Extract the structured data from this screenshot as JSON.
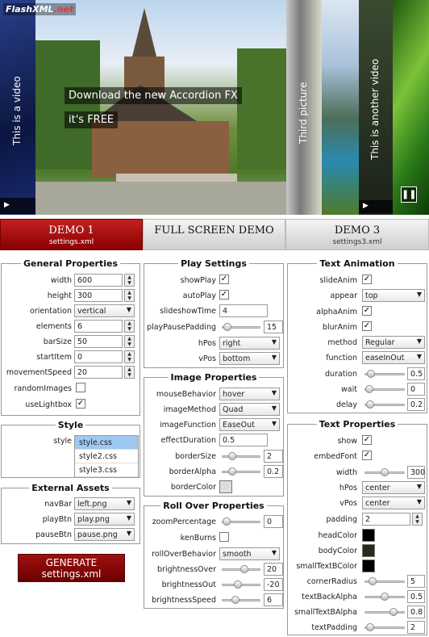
{
  "logo": {
    "flash": "FlashXML",
    "dotnet": ".net"
  },
  "slideshow": {
    "label_video1": "This is a video",
    "overlay_line1": "Download the new Accordion FX",
    "overlay_line2": "it's FREE",
    "label_third": "Third picture",
    "label_video2": "This is another video"
  },
  "tabs": [
    {
      "title": "DEMO 1",
      "file": "settings.xml",
      "active": true
    },
    {
      "title": "FULL SCREEN DEMO",
      "file": ""
    },
    {
      "title": "DEMO 3",
      "file": "settings3.xml"
    }
  ],
  "general": {
    "title": "General Properties",
    "width": {
      "label": "width",
      "value": "600"
    },
    "height": {
      "label": "height",
      "value": "300"
    },
    "orientation": {
      "label": "orientation",
      "value": "vertical"
    },
    "elements": {
      "label": "elements",
      "value": "6"
    },
    "barSize": {
      "label": "barSize",
      "value": "50"
    },
    "startItem": {
      "label": "startItem",
      "value": "0"
    },
    "movementSpeed": {
      "label": "movementSpeed",
      "value": "20"
    },
    "randomImages": {
      "label": "randomImages",
      "checked": false
    },
    "useLightbox": {
      "label": "useLightbox",
      "checked": true
    }
  },
  "style": {
    "title": "Style",
    "label": "style",
    "options": [
      "style.css",
      "style2.css",
      "style3.css"
    ],
    "selected": "style.css"
  },
  "external": {
    "title": "External Assets",
    "navBar": {
      "label": "navBar",
      "value": "left.png"
    },
    "playBtn": {
      "label": "playBtn",
      "value": "play.png"
    },
    "pauseBtn": {
      "label": "pauseBtn",
      "value": "pause.png"
    }
  },
  "generate": {
    "line1": "GENERATE",
    "line2": "settings.xml"
  },
  "play": {
    "title": "Play Settings",
    "showPlay": {
      "label": "showPlay",
      "checked": true
    },
    "autoPlay": {
      "label": "autoPlay",
      "checked": true
    },
    "slideshowTime": {
      "label": "slideshowTime",
      "value": "4"
    },
    "playPausePadding": {
      "label": "playPausePadding",
      "value": "15",
      "level": 0.02
    },
    "hPos": {
      "label": "hPos",
      "value": "right"
    },
    "vPos": {
      "label": "vPos",
      "value": "bottom"
    }
  },
  "image": {
    "title": "Image Properties",
    "mouseBehavior": {
      "label": "mouseBehavior",
      "value": "hover"
    },
    "imageMethod": {
      "label": "imageMethod",
      "value": "Quad"
    },
    "imageFunction": {
      "label": "imageFunction",
      "value": "EaseOut"
    },
    "effectDuration": {
      "label": "effectDuration",
      "value": "0.5"
    },
    "borderSize": {
      "label": "borderSize",
      "value": "2",
      "level": 0.2
    },
    "borderAlpha": {
      "label": "borderAlpha",
      "value": "0.2",
      "level": 0.2
    },
    "borderColor": {
      "label": "borderColor",
      "color": "#dddddd"
    }
  },
  "rollover": {
    "title": "Roll Over Properties",
    "zoomPercentage": {
      "label": "zoomPercentage",
      "value": "0",
      "level": 0.0
    },
    "kenBurns": {
      "label": "kenBurns",
      "checked": false
    },
    "rollOverBehavior": {
      "label": "rollOverBehavior",
      "value": "smooth"
    },
    "brightnessOver": {
      "label": "brightnessOver",
      "value": "20",
      "level": 0.6
    },
    "brightnessOut": {
      "label": "brightnessOut",
      "value": "-20",
      "level": 0.4
    },
    "brightnessSpeed": {
      "label": "brightnessSpeed",
      "value": "6",
      "level": 0.3
    }
  },
  "textanim": {
    "title": "Text Animation",
    "slideAnim": {
      "label": "slideAnim",
      "checked": true
    },
    "appear": {
      "label": "appear",
      "value": "top"
    },
    "alphaAnim": {
      "label": "alphaAnim",
      "checked": true
    },
    "blurAnim": {
      "label": "blurAnim",
      "checked": true
    },
    "method": {
      "label": "method",
      "value": "Regular"
    },
    "function": {
      "label": "function",
      "value": "easeInOut"
    },
    "duration": {
      "label": "duration",
      "value": "0.5",
      "level": 0.05
    },
    "wait": {
      "label": "wait",
      "value": "0",
      "level": 0.0
    },
    "delay": {
      "label": "delay",
      "value": "0.2",
      "level": 0.02
    }
  },
  "textprops": {
    "title": "Text Properties",
    "show": {
      "label": "show",
      "checked": true
    },
    "embedFont": {
      "label": "embedFont",
      "checked": true
    },
    "width": {
      "label": "width",
      "value": "300",
      "level": 0.5
    },
    "hPos": {
      "label": "hPos",
      "value": "center"
    },
    "vPos": {
      "label": "vPos",
      "value": "center"
    },
    "padding": {
      "label": "padding",
      "value": "2"
    },
    "headColor": {
      "label": "headColor",
      "color": "#000000"
    },
    "bodyColor": {
      "label": "bodyColor",
      "color": "#2a2a1a"
    },
    "smallTextBColor": {
      "label": "smallTextBColor",
      "color": "#000000"
    },
    "cornerRadius": {
      "label": "cornerRadius",
      "value": "5",
      "level": 0.1
    },
    "textBackAlpha": {
      "label": "textBackAlpha",
      "value": "0.5",
      "level": 0.5
    },
    "smallTextBAlpha": {
      "label": "smallTextBAlpha",
      "value": "0.8",
      "level": 0.8
    },
    "textPadding": {
      "label": "textPadding",
      "value": "2",
      "level": 0.02
    }
  }
}
